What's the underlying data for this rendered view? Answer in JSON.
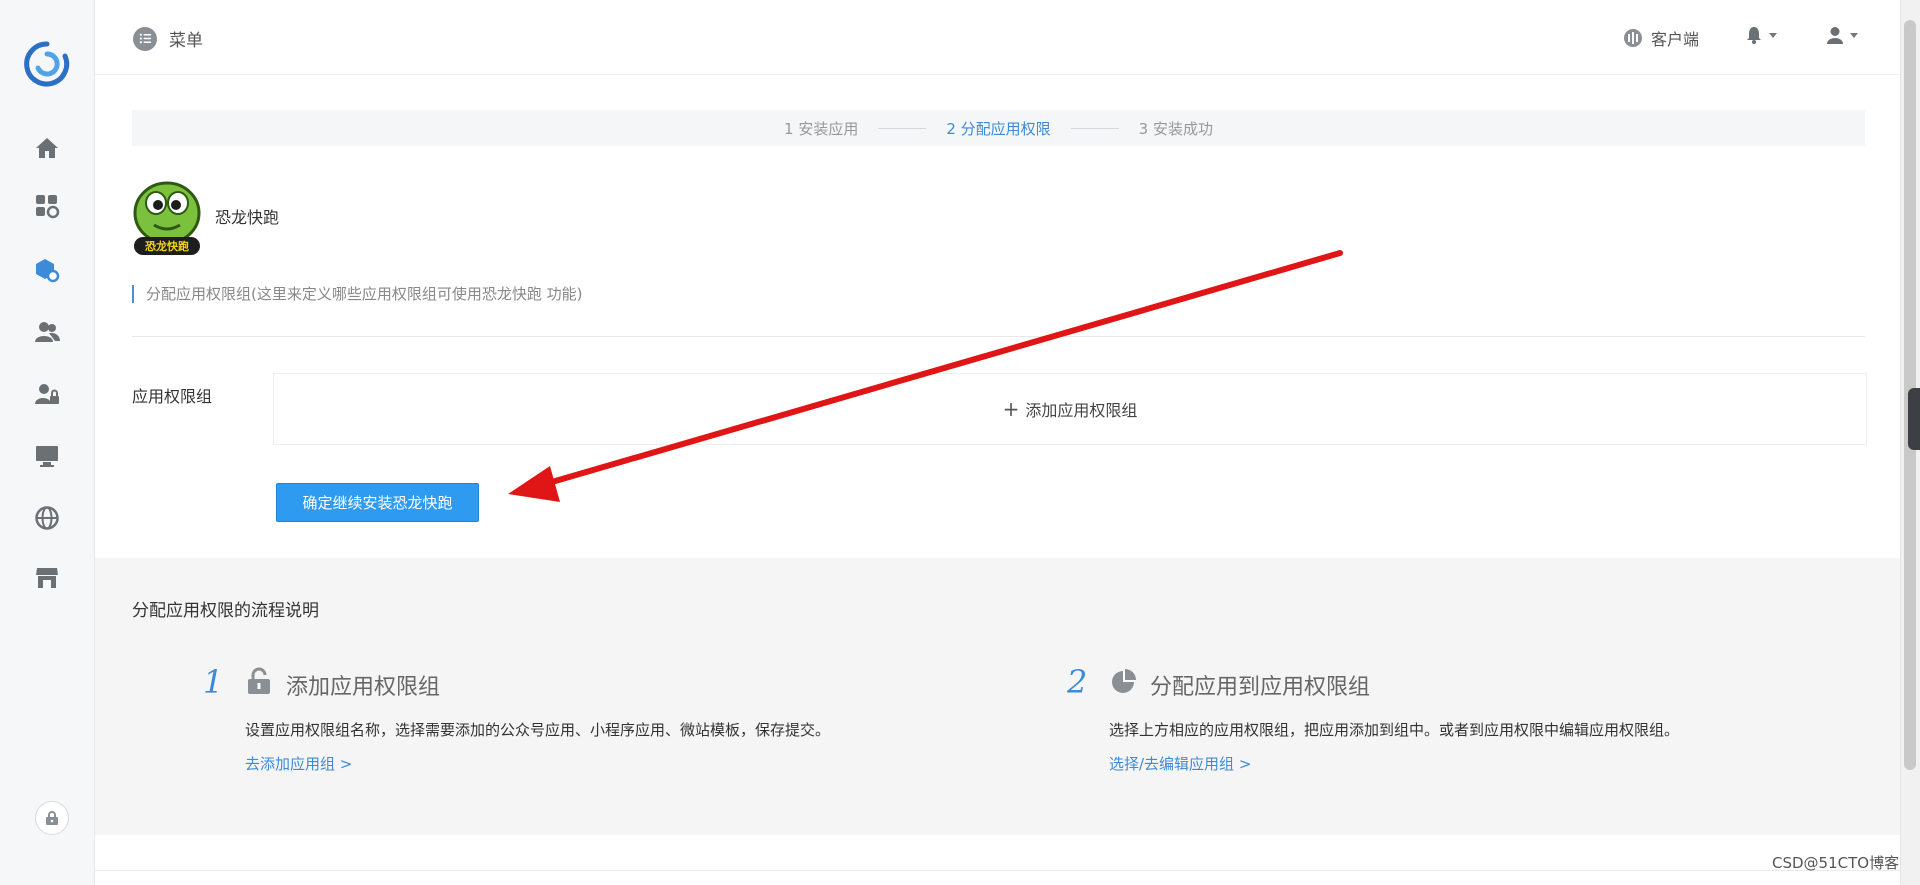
{
  "topbar": {
    "menu_label": "菜单",
    "client_label": "客户端"
  },
  "sidebar": {
    "items": [
      {
        "icon": "home-icon"
      },
      {
        "icon": "apps-settings-icon"
      },
      {
        "icon": "package-settings-icon"
      },
      {
        "icon": "users-icon"
      },
      {
        "icon": "user-lock-icon"
      },
      {
        "icon": "monitor-icon"
      },
      {
        "icon": "globe-icon"
      },
      {
        "icon": "store-icon"
      }
    ]
  },
  "steps": {
    "step1": "1 安装应用",
    "step2": "2 分配应用权限",
    "step3": "3 安装成功",
    "active": 2
  },
  "app": {
    "name": "恐龙快跑",
    "icon_text": "恐龙快跑",
    "note": "分配应用权限组(这里来定义哪些应用权限组可使用恐龙快跑 功能)"
  },
  "form": {
    "label": "应用权限组",
    "add_label": "添加应用权限组",
    "confirm_label": "确定继续安装恐龙快跑"
  },
  "process": {
    "title": "分配应用权限的流程说明",
    "steps": [
      {
        "num": "1",
        "icon": "lock-icon",
        "head": "添加应用权限组",
        "desc": "设置应用权限组名称，选择需要添加的公众号应用、小程序应用、微站模板，保存提交。",
        "link": "去添加应用组 >"
      },
      {
        "num": "2",
        "icon": "pie-chart-icon",
        "head": "分配应用到应用权限组",
        "desc": "选择上方相应的应用权限组，把应用添加到组中。或者到应用权限中编辑应用权限组。",
        "link": "选择/去编辑应用组 >"
      }
    ]
  },
  "watermark": "CSD@51CTO博客",
  "colors": {
    "accent": "#3d8bd8",
    "button": "#2f9bf0",
    "arrow": "#e01515"
  }
}
